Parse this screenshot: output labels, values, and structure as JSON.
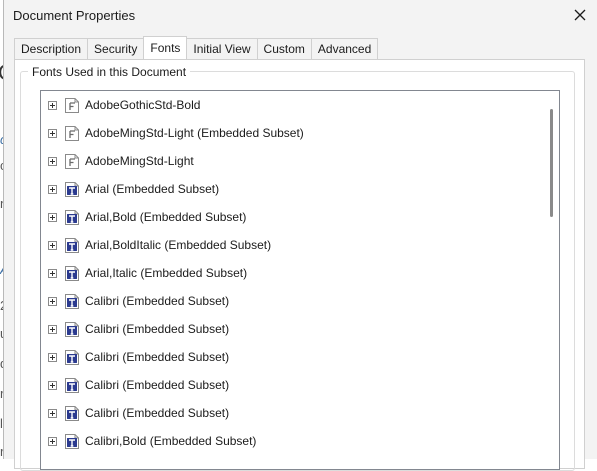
{
  "dialog": {
    "title": "Document Properties",
    "close_icon": "close-icon"
  },
  "tabs": [
    {
      "label": "Description",
      "active": false
    },
    {
      "label": "Security",
      "active": false
    },
    {
      "label": "Fonts",
      "active": true
    },
    {
      "label": "Initial View",
      "active": false
    },
    {
      "label": "Custom",
      "active": false
    },
    {
      "label": "Advanced",
      "active": false
    }
  ],
  "fonts_group": {
    "label": "Fonts Used in this Document"
  },
  "fonts": [
    {
      "name": "AdobeGothicStd-Bold",
      "icon": "type1-font-icon"
    },
    {
      "name": "AdobeMingStd-Light (Embedded Subset)",
      "icon": "type1-font-icon"
    },
    {
      "name": "AdobeMingStd-Light",
      "icon": "type1-font-icon"
    },
    {
      "name": "Arial (Embedded Subset)",
      "icon": "truetype-font-icon"
    },
    {
      "name": "Arial,Bold (Embedded Subset)",
      "icon": "truetype-font-icon"
    },
    {
      "name": "Arial,BoldItalic (Embedded Subset)",
      "icon": "truetype-font-icon"
    },
    {
      "name": "Arial,Italic (Embedded Subset)",
      "icon": "truetype-font-icon"
    },
    {
      "name": "Calibri (Embedded Subset)",
      "icon": "truetype-font-icon"
    },
    {
      "name": "Calibri (Embedded Subset)",
      "icon": "truetype-font-icon"
    },
    {
      "name": "Calibri (Embedded Subset)",
      "icon": "truetype-font-icon"
    },
    {
      "name": "Calibri (Embedded Subset)",
      "icon": "truetype-font-icon"
    },
    {
      "name": "Calibri (Embedded Subset)",
      "icon": "truetype-font-icon"
    },
    {
      "name": "Calibri,Bold (Embedded Subset)",
      "icon": "truetype-font-icon"
    }
  ],
  "colors": {
    "dialog_bg": "#f3f3f3",
    "panel_bg": "#ffffff",
    "truetype_icon_blue": "#2b3a8f"
  }
}
